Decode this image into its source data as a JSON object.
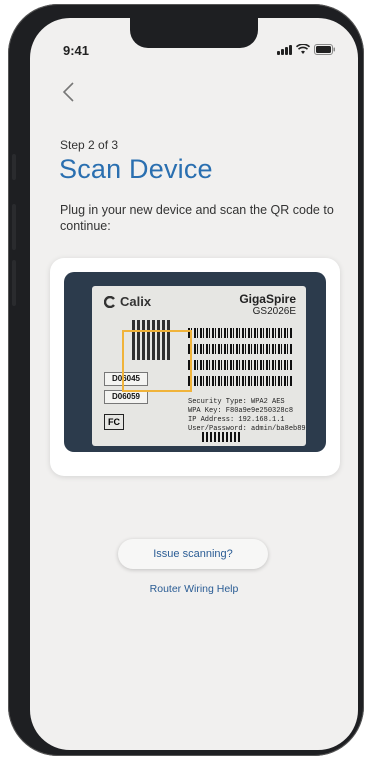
{
  "status": {
    "time": "9:41"
  },
  "header": {
    "step": "Step 2 of 3",
    "title": "Scan Device"
  },
  "instructions": "Plug in your new device and scan the QR code to continue:",
  "device_label": {
    "brand": "Calix",
    "model_line1": "GigaSpire",
    "model_line2": "GS2026E",
    "code_top": "D06045",
    "code_bottom": "D06059",
    "security_lines": [
      "Security Type:  WPA2 AES",
      "WPA Key:  F80a9e9e250328c8",
      "IP Address:  192.168.1.1",
      "User/Password: admin/ba8eb89"
    ]
  },
  "actions": {
    "issue_label": "Issue scanning?",
    "help_link": "Router Wiring Help"
  },
  "colors": {
    "title": "#2a6fb0",
    "link": "#2a5c94",
    "screen_bg": "#f1f0ef"
  }
}
